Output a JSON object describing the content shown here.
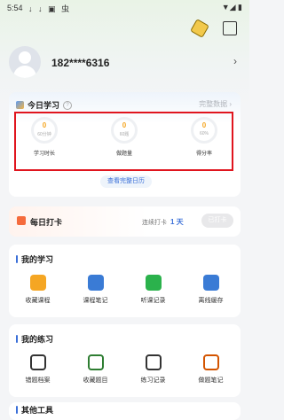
{
  "status_bar": {
    "time": "5:54",
    "left_icons": "↓ ↓ ▣ 虫",
    "right_icons": "▼◢ ▮"
  },
  "header": {
    "icons": [
      "badge-icon",
      "message-icon"
    ]
  },
  "profile": {
    "phone": "182****6316",
    "chevron": "›"
  },
  "today_study": {
    "title": "今日学习",
    "help": "?",
    "full_data_link": "完整数据 ›",
    "stats": [
      {
        "value": "0",
        "unit": "60分钟",
        "label": "学习时长"
      },
      {
        "value": "0",
        "unit": "60题",
        "label": "做题量"
      },
      {
        "value": "0",
        "unit": "60%",
        "label": "得分率"
      }
    ],
    "calendar_button": "查看完整日历"
  },
  "checkin": {
    "title": "每日打卡",
    "streak_label": "连续打卡",
    "streak_value": "1 天",
    "button": "已打卡"
  },
  "my_study": {
    "title": "我的学习",
    "items": [
      {
        "label": "收藏课程",
        "icon": "course-icon",
        "color": "#f5a623"
      },
      {
        "label": "课程笔记",
        "icon": "notebook-icon",
        "color": "#3a7bd5"
      },
      {
        "label": "听课记录",
        "icon": "record-icon",
        "color": "#2bb24c"
      },
      {
        "label": "离线缓存",
        "icon": "cache-icon",
        "color": "#3a7bd5"
      }
    ]
  },
  "my_practice": {
    "title": "我的练习",
    "items": [
      {
        "label": "错题档案",
        "icon": "wrong-archive-icon",
        "color": "#333333"
      },
      {
        "label": "收藏题目",
        "icon": "fav-question-icon",
        "color": "#2e7d32"
      },
      {
        "label": "练习记录",
        "icon": "practice-record-icon",
        "color": "#333333"
      },
      {
        "label": "做题笔记",
        "icon": "question-note-icon",
        "color": "#d35400"
      }
    ]
  },
  "other_tools": {
    "title": "其他工具"
  }
}
